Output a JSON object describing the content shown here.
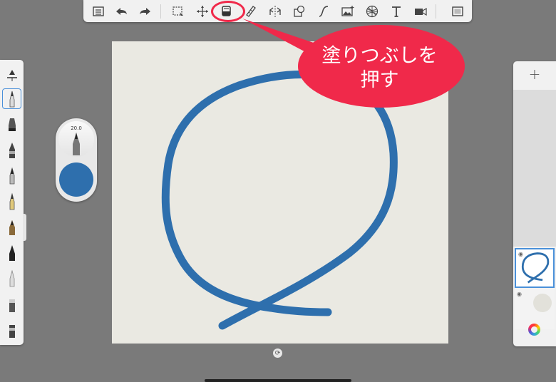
{
  "toolbar": {
    "tools": [
      {
        "icon": "list-icon"
      },
      {
        "icon": "undo-icon"
      },
      {
        "icon": "redo-icon"
      },
      {
        "icon": "selection-icon"
      },
      {
        "icon": "transform-icon"
      },
      {
        "icon": "fill-bucket-icon",
        "highlighted": true
      },
      {
        "icon": "ruler-icon"
      },
      {
        "icon": "symmetry-icon"
      },
      {
        "icon": "shapes-icon"
      },
      {
        "icon": "curve-icon"
      },
      {
        "icon": "image-icon"
      },
      {
        "icon": "perspective-icon"
      },
      {
        "icon": "text-icon"
      },
      {
        "icon": "video-icon"
      },
      {
        "icon": "fullscreen-icon"
      }
    ]
  },
  "callout": {
    "line1": "塗りつぶしを",
    "line2": "押す",
    "color": "#f0294a"
  },
  "brush": {
    "size_label": "20.0",
    "color": "#2e6fad"
  },
  "layers": {
    "add_label": "+"
  },
  "canvas": {
    "background": "#eae9e2",
    "stroke_color": "#2e6fad"
  }
}
